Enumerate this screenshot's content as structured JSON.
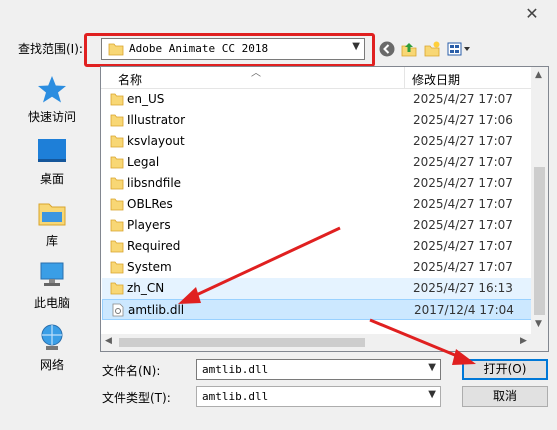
{
  "dialog": {
    "close_glyph": "✕"
  },
  "lookin": {
    "label": "查找范围(I):",
    "value": "Adobe Animate CC 2018"
  },
  "places": [
    {
      "label": "快速访问",
      "icon": "star-icon"
    },
    {
      "label": "桌面",
      "icon": "desktop-icon"
    },
    {
      "label": "库",
      "icon": "library-icon"
    },
    {
      "label": "此电脑",
      "icon": "computer-icon"
    },
    {
      "label": "网络",
      "icon": "network-icon"
    }
  ],
  "columns": {
    "name": "名称",
    "date": "修改日期"
  },
  "files": [
    {
      "name": "en_US",
      "date": "2025/4/27 17:07",
      "type": "folder"
    },
    {
      "name": "Illustrator",
      "date": "2025/4/27 17:06",
      "type": "folder"
    },
    {
      "name": "ksvlayout",
      "date": "2025/4/27 17:07",
      "type": "folder"
    },
    {
      "name": "Legal",
      "date": "2025/4/27 17:07",
      "type": "folder"
    },
    {
      "name": "libsndfile",
      "date": "2025/4/27 17:07",
      "type": "folder"
    },
    {
      "name": "OBLRes",
      "date": "2025/4/27 17:07",
      "type": "folder"
    },
    {
      "name": "Players",
      "date": "2025/4/27 17:07",
      "type": "folder"
    },
    {
      "name": "Required",
      "date": "2025/4/27 17:07",
      "type": "folder"
    },
    {
      "name": "System",
      "date": "2025/4/27 17:07",
      "type": "folder"
    },
    {
      "name": "zh_CN",
      "date": "2025/4/27 16:13",
      "type": "folder"
    },
    {
      "name": "amtlib.dll",
      "date": "2017/12/4 17:04",
      "type": "dll"
    }
  ],
  "filename": {
    "label": "文件名(N):",
    "value": "amtlib.dll"
  },
  "filetype": {
    "label": "文件类型(T):",
    "value": "amtlib.dll"
  },
  "buttons": {
    "open": "打开(O)",
    "cancel": "取消"
  },
  "colors": {
    "highlight_red": "#e02020",
    "selection": "#cce8ff",
    "folder_yellow": "#f8d775"
  }
}
